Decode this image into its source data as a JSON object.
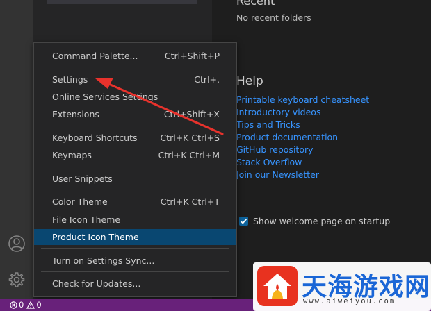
{
  "welcome": {
    "recent_title": "Recent",
    "recent_empty": "No recent folders",
    "help_title": "Help",
    "help_links": [
      "Printable keyboard cheatsheet",
      "Introductory videos",
      "Tips and Tricks",
      "Product documentation",
      "GitHub repository",
      "Stack Overflow",
      "Join our Newsletter"
    ],
    "startup_label": "Show welcome page on startup",
    "startup_checked": true
  },
  "menu": {
    "items": [
      {
        "label": "Command Palette...",
        "shortcut": "Ctrl+Shift+P"
      },
      {
        "label": "Settings",
        "shortcut": "Ctrl+,"
      },
      {
        "label": "Online Services Settings",
        "shortcut": ""
      },
      {
        "label": "Extensions",
        "shortcut": "Ctrl+Shift+X"
      },
      {
        "label": "Keyboard Shortcuts",
        "shortcut": "Ctrl+K Ctrl+S"
      },
      {
        "label": "Keymaps",
        "shortcut": "Ctrl+K Ctrl+M"
      },
      {
        "label": "User Snippets",
        "shortcut": ""
      },
      {
        "label": "Color Theme",
        "shortcut": "Ctrl+K Ctrl+T"
      },
      {
        "label": "File Icon Theme",
        "shortcut": ""
      },
      {
        "label": "Product Icon Theme",
        "shortcut": ""
      },
      {
        "label": "Turn on Settings Sync...",
        "shortcut": ""
      },
      {
        "label": "Check for Updates...",
        "shortcut": ""
      }
    ],
    "active_item": "Product Icon Theme"
  },
  "activity_bar": {
    "icons": [
      "account-icon",
      "gear-icon"
    ]
  },
  "status_bar": {
    "errors": "0",
    "warnings": "0"
  },
  "watermark": {
    "brand": "天海游戏网",
    "url": "www.aiweiyou.com"
  },
  "colors": {
    "status_bar": "#68217a",
    "menu_active": "#094771",
    "link": "#3794ff",
    "arrow": "#e8322c"
  }
}
